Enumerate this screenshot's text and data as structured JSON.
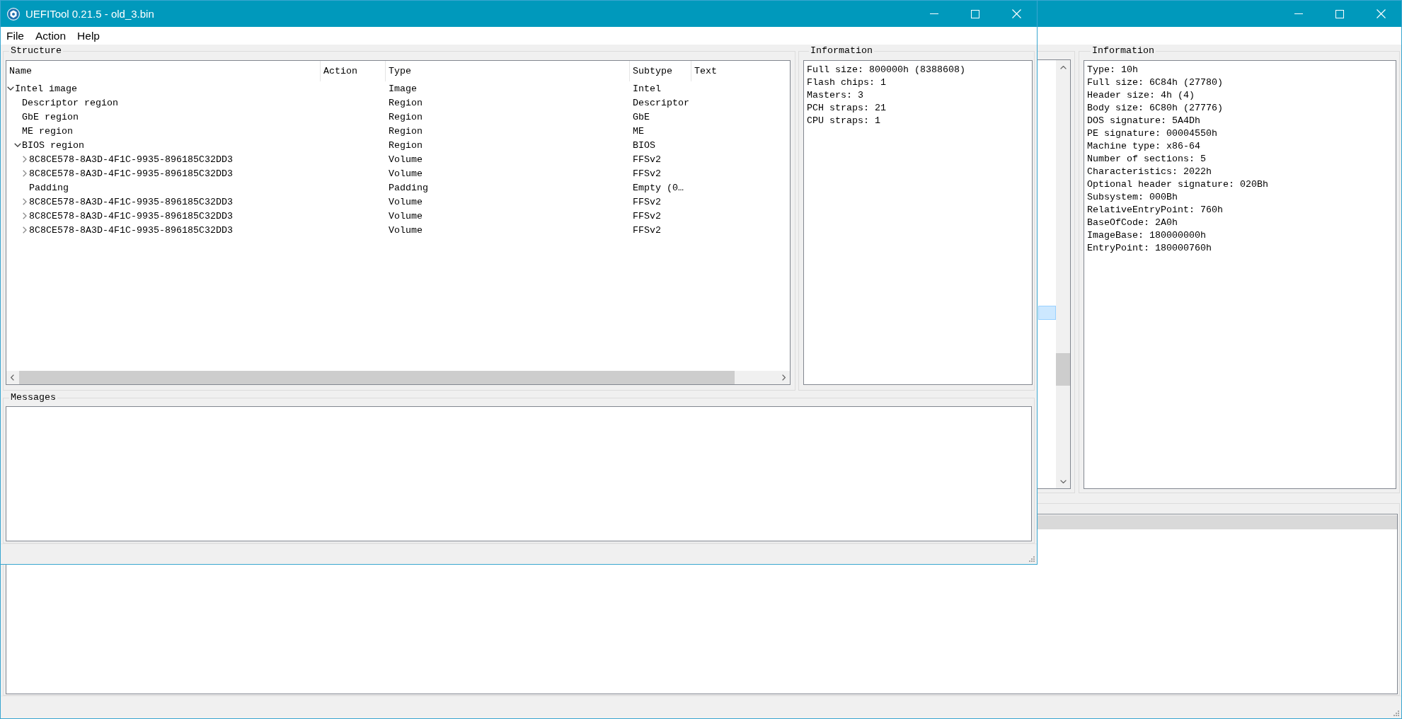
{
  "front_window": {
    "title": "UEFITool 0.21.5 - old_3.bin",
    "menu": [
      "File",
      "Action",
      "Help"
    ],
    "structure": {
      "title": "Structure",
      "columns": [
        "Name",
        "Action",
        "Type",
        "Subtype",
        "Text"
      ],
      "rows": [
        {
          "name": "Intel image",
          "type": "Image",
          "subtype": "Intel",
          "kind": "branch",
          "expanded": true,
          "children": [
            {
              "name": "Descriptor region",
              "type": "Region",
              "subtype": "Descriptor",
              "kind": "leaf"
            },
            {
              "name": "GbE region",
              "type": "Region",
              "subtype": "GbE",
              "kind": "leaf"
            },
            {
              "name": "ME region",
              "type": "Region",
              "subtype": "ME",
              "kind": "leaf"
            },
            {
              "name": "BIOS region",
              "type": "Region",
              "subtype": "BIOS",
              "kind": "branch",
              "expanded": true,
              "children": [
                {
                  "name": "8C8CE578-8A3D-4F1C-9935-896185C32DD3",
                  "type": "Volume",
                  "subtype": "FFSv2",
                  "kind": "branch",
                  "expanded": false
                },
                {
                  "name": "8C8CE578-8A3D-4F1C-9935-896185C32DD3",
                  "type": "Volume",
                  "subtype": "FFSv2",
                  "kind": "branch",
                  "expanded": false
                },
                {
                  "name": "Padding",
                  "type": "Padding",
                  "subtype": "Empty (0…",
                  "kind": "leaf"
                },
                {
                  "name": "8C8CE578-8A3D-4F1C-9935-896185C32DD3",
                  "type": "Volume",
                  "subtype": "FFSv2",
                  "kind": "branch",
                  "expanded": false
                },
                {
                  "name": "8C8CE578-8A3D-4F1C-9935-896185C32DD3",
                  "type": "Volume",
                  "subtype": "FFSv2",
                  "kind": "branch",
                  "expanded": false
                },
                {
                  "name": "8C8CE578-8A3D-4F1C-9935-896185C32DD3",
                  "type": "Volume",
                  "subtype": "FFSv2",
                  "kind": "branch",
                  "expanded": false
                }
              ]
            }
          ]
        }
      ]
    },
    "information": {
      "title": "Information",
      "lines": [
        "Full size: 800000h (8388608)",
        "Flash chips: 1",
        "Masters: 3",
        "PCH straps: 21",
        "CPU straps: 1"
      ]
    },
    "messages": {
      "title": "Messages"
    }
  },
  "back_window": {
    "information": {
      "title": "Information",
      "lines": [
        "Type: 10h",
        "Full size: 6C84h (27780)",
        "Header size: 4h (4)",
        "Body size: 6C80h (27776)",
        "DOS signature: 5A4Dh",
        "PE signature: 00004550h",
        "Machine type: x86-64",
        "Number of sections: 5",
        "Characteristics: 2022h",
        "Optional header signature: 020Bh",
        "Subsystem: 000Bh",
        "RelativeEntryPoint: 760h",
        "BaseOfCode: 2A0h",
        "ImageBase: 180000000h",
        "EntryPoint: 180000760h"
      ]
    }
  }
}
